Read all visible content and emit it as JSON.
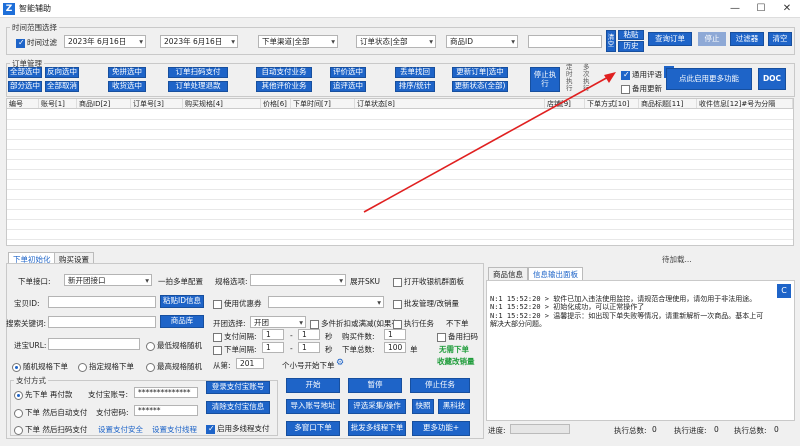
{
  "window": {
    "title": "智能辅助",
    "min": "—",
    "max": "☐",
    "close": "✕"
  },
  "time_filter": {
    "group_label": "时间范围选择",
    "checkbox_label": "时间过滤",
    "start_date": "2023年 6月16日",
    "end_date": "2023年 6月16日",
    "channel": "下单渠道|全部",
    "order_status": "订单状态|全部",
    "product": "商品ID",
    "search_value": "",
    "buttons": {
      "clear": "清空",
      "paste": "粘贴",
      "history": "历史",
      "query": "查询订单",
      "stop": "停止",
      "filter": "过滤器",
      "clear2": "清空"
    }
  },
  "order_mgmt": {
    "group_label": "订单管理",
    "row1": [
      "全部选中",
      "反向选中",
      "免拼选中",
      "订单扫码支付",
      "自动支付业务",
      "评价选中",
      "丢单找回",
      "更新订单|选中"
    ],
    "row2": [
      "部分选中",
      "全部取消",
      "收货选中",
      "订单处理退款",
      "其他评价业务",
      "追评选中",
      "排序/统计",
      "更新状态(全部)"
    ],
    "stop_exec": "停止执行",
    "timer_label": "定时执行",
    "multi_label": "多次执行",
    "general_eval": "通用评语",
    "backup_update": "备用更新",
    "more_features": "点此启用更多功能",
    "doc": "DOC"
  },
  "grid": {
    "columns": [
      "编号",
      "账号[1]",
      "商品ID[2]",
      "订单号[3]",
      "购买规格[4]",
      "价格[6]",
      "下单时间[7]",
      "订单状态[8]",
      "店铺[9]",
      "下单方式[10]",
      "商品标题[11]",
      "收件信息[12]#号为分隔"
    ]
  },
  "status": {
    "waiting": "待加载..."
  },
  "tabs_left": [
    "下单初始化",
    "购买设置"
  ],
  "order_form": {
    "iface_label": "下单接口:",
    "iface_value": "新开团接口",
    "one_click": "一拍多单配置",
    "spec_label": "规格选项:",
    "spec_value": "",
    "show_spec": "展开SKU",
    "open_browser": "打开收银机群面板",
    "bao_label": "宝贝ID:",
    "bao_btn": "粘贴ID信息",
    "coupon": "使用优惠券",
    "batch": "批发管理/改销量",
    "search_label": "搜索关键词:",
    "shop_btn": "商品库",
    "group_label": "开团选择:",
    "group_value": "开团",
    "multi_discount": "多件折扣或满减(如果有)",
    "exec_task": "执行任务",
    "no_order": "不下单",
    "inbound_label": "进宝URL:",
    "lowest_size": "最低规格随机",
    "interval_label": "支付间隔:",
    "interval_a": "1",
    "interval_b": "1",
    "sec": "秒",
    "buy_count_label": "购买件数:",
    "buy_count": "1",
    "backup_scan": "备用扫码",
    "random_order": "随机规格下单",
    "spec_order": "指定规格下单",
    "highest_size": "最高规格随机",
    "order_interval_label": "下单间隔:",
    "order_a": "1",
    "order_b": "1",
    "total_label": "下单总数:",
    "total": "100",
    "unit": "单",
    "no_order_green": "无需下单",
    "from_label": "从第:",
    "from_value": "201",
    "per_account": "个小号开始下单",
    "close_account": "收藏改销量"
  },
  "pay": {
    "group_label": "支付方式",
    "first_order": "先下单 再付款",
    "pay_account_label": "支付宝账号:",
    "pay_account": "**************",
    "pay_pwd_label": "支付密码:",
    "pay_pwd": "******",
    "after_order": "下单 然后自动支付",
    "after_scan": "下单 然后扫码支付",
    "pay_safe": "设置支付安全",
    "pay_thread": "设置支付线程",
    "login_alipay": "登录支付宝账号",
    "clear_alipay": "清除支付宝信息",
    "multi_thread": "启用多线程支付"
  },
  "actions": {
    "start": "开始",
    "pause": "暂停",
    "stop_task": "停止任务",
    "import_addr": "导入账号地址",
    "eval_collect": "评选采集/操作",
    "quick": "快照",
    "black_tech": "黑科技",
    "multi_order": "多窗口下单",
    "batch_order": "批发多线程下单",
    "more": "更多功能+"
  },
  "right_tabs": [
    "商品信息",
    "信息输出面板"
  ],
  "log": [
    "N:1 15:52:20 > 软件已加入违法使用监控，请规范合理使用，请勿用于非法用途。",
    "N:1 15:52:20 > 初始化成功，可以正常操作了",
    "N:1 15:52:20 > 温馨提示：如出现下单失败等情况，请重新解析一次商品。基本上可",
    "解决大部分问题。"
  ],
  "progress": {
    "label": "进度:",
    "exec_total": "执行总数:",
    "exec_total_v": "0",
    "exec_progress": "执行进度:",
    "exec_progress_v": "0",
    "exec_count": "执行总数:",
    "exec_count_v": "0"
  }
}
